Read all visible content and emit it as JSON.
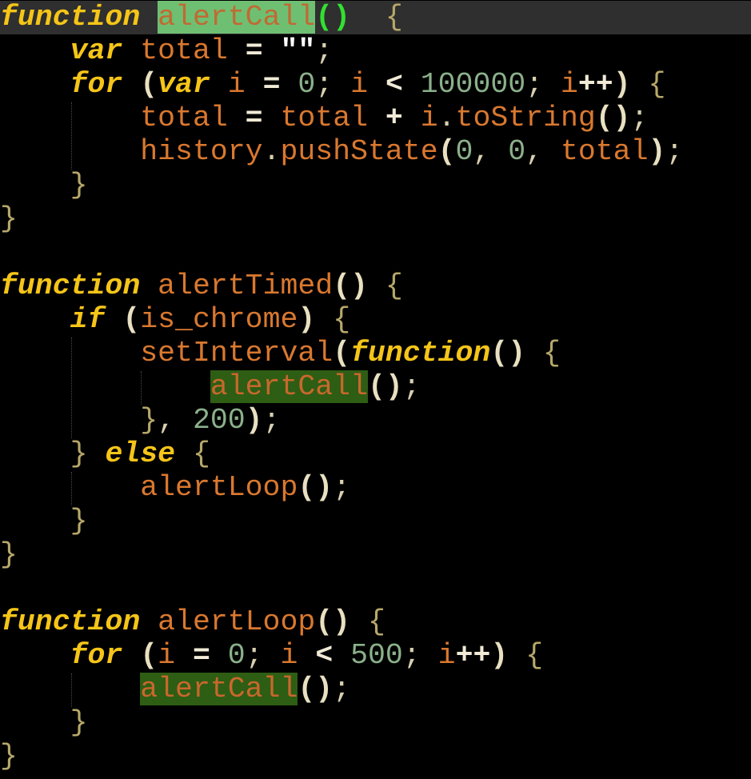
{
  "editor": {
    "language": "javascript",
    "current_line": 1,
    "colors": {
      "background": "#000000",
      "current_line": "#2f2f2f",
      "keyword": "#f5c518",
      "identifier": "#d9782f",
      "number": "#8bb08b",
      "selection_current": "#6fbf73",
      "selection_other": "#2e5d14",
      "matching_paren": "#32e032"
    },
    "lines": [
      {
        "n": 1,
        "indent": "",
        "tokens": [
          [
            "kw",
            "function"
          ],
          [
            "sp",
            " "
          ],
          [
            "hl-cur",
            "alertCall"
          ],
          [
            "paren-match",
            "()"
          ],
          [
            "sp",
            "  "
          ],
          [
            "brace",
            "{"
          ]
        ]
      },
      {
        "n": 2,
        "indent": "    ",
        "tokens": [
          [
            "kw",
            "var"
          ],
          [
            "sp",
            " "
          ],
          [
            "id",
            "total"
          ],
          [
            "sp",
            " "
          ],
          [
            "op",
            "="
          ],
          [
            "sp",
            " "
          ],
          [
            "str",
            "\"\""
          ],
          [
            "punc",
            ";"
          ]
        ]
      },
      {
        "n": 3,
        "indent": "    ",
        "tokens": [
          [
            "kw",
            "for"
          ],
          [
            "sp",
            " "
          ],
          [
            "paren",
            "("
          ],
          [
            "kw",
            "var"
          ],
          [
            "sp",
            " "
          ],
          [
            "id",
            "i"
          ],
          [
            "sp",
            " "
          ],
          [
            "op",
            "="
          ],
          [
            "sp",
            " "
          ],
          [
            "num",
            "0"
          ],
          [
            "punc",
            ";"
          ],
          [
            "sp",
            " "
          ],
          [
            "id",
            "i"
          ],
          [
            "sp",
            " "
          ],
          [
            "op",
            "<"
          ],
          [
            "sp",
            " "
          ],
          [
            "num",
            "100000"
          ],
          [
            "punc",
            ";"
          ],
          [
            "sp",
            " "
          ],
          [
            "id",
            "i"
          ],
          [
            "op",
            "++"
          ],
          [
            "paren",
            ")"
          ],
          [
            "sp",
            " "
          ],
          [
            "brace",
            "{"
          ]
        ]
      },
      {
        "n": 4,
        "indent": "        ",
        "tokens": [
          [
            "id",
            "total"
          ],
          [
            "sp",
            " "
          ],
          [
            "op",
            "="
          ],
          [
            "sp",
            " "
          ],
          [
            "id",
            "total"
          ],
          [
            "sp",
            " "
          ],
          [
            "op",
            "+"
          ],
          [
            "sp",
            " "
          ],
          [
            "id",
            "i"
          ],
          [
            "punc",
            "."
          ],
          [
            "id",
            "toString"
          ],
          [
            "paren",
            "()"
          ],
          [
            "punc",
            ";"
          ]
        ]
      },
      {
        "n": 5,
        "indent": "        ",
        "tokens": [
          [
            "id",
            "history"
          ],
          [
            "punc",
            "."
          ],
          [
            "id",
            "pushState"
          ],
          [
            "paren",
            "("
          ],
          [
            "num",
            "0"
          ],
          [
            "punc",
            ","
          ],
          [
            "sp",
            " "
          ],
          [
            "num",
            "0"
          ],
          [
            "punc",
            ","
          ],
          [
            "sp",
            " "
          ],
          [
            "id",
            "total"
          ],
          [
            "paren",
            ")"
          ],
          [
            "punc",
            ";"
          ]
        ]
      },
      {
        "n": 6,
        "indent": "    ",
        "tokens": [
          [
            "brace",
            "}"
          ]
        ]
      },
      {
        "n": 7,
        "indent": "",
        "tokens": [
          [
            "brace",
            "}"
          ]
        ]
      },
      {
        "n": 8,
        "indent": "",
        "tokens": []
      },
      {
        "n": 9,
        "indent": "",
        "tokens": [
          [
            "kw",
            "function"
          ],
          [
            "sp",
            " "
          ],
          [
            "id",
            "alertTimed"
          ],
          [
            "paren",
            "()"
          ],
          [
            "sp",
            " "
          ],
          [
            "brace",
            "{"
          ]
        ]
      },
      {
        "n": 10,
        "indent": "    ",
        "tokens": [
          [
            "kw",
            "if"
          ],
          [
            "sp",
            " "
          ],
          [
            "paren",
            "("
          ],
          [
            "id",
            "is_chrome"
          ],
          [
            "paren",
            ")"
          ],
          [
            "sp",
            " "
          ],
          [
            "brace",
            "{"
          ]
        ]
      },
      {
        "n": 11,
        "indent": "        ",
        "tokens": [
          [
            "id",
            "setInterval"
          ],
          [
            "paren",
            "("
          ],
          [
            "kw",
            "function"
          ],
          [
            "paren",
            "()"
          ],
          [
            "sp",
            " "
          ],
          [
            "brace",
            "{"
          ]
        ]
      },
      {
        "n": 12,
        "indent": "            ",
        "tokens": [
          [
            "hl",
            "alertCall"
          ],
          [
            "paren",
            "()"
          ],
          [
            "punc",
            ";"
          ]
        ]
      },
      {
        "n": 13,
        "indent": "        ",
        "tokens": [
          [
            "brace",
            "}"
          ],
          [
            "punc",
            ","
          ],
          [
            "sp",
            " "
          ],
          [
            "num",
            "200"
          ],
          [
            "paren",
            ")"
          ],
          [
            "punc",
            ";"
          ]
        ]
      },
      {
        "n": 14,
        "indent": "    ",
        "tokens": [
          [
            "brace",
            "}"
          ],
          [
            "sp",
            " "
          ],
          [
            "kw",
            "else"
          ],
          [
            "sp",
            " "
          ],
          [
            "brace",
            "{"
          ]
        ]
      },
      {
        "n": 15,
        "indent": "        ",
        "tokens": [
          [
            "id",
            "alertLoop"
          ],
          [
            "paren",
            "()"
          ],
          [
            "punc",
            ";"
          ]
        ]
      },
      {
        "n": 16,
        "indent": "    ",
        "tokens": [
          [
            "brace",
            "}"
          ]
        ]
      },
      {
        "n": 17,
        "indent": "",
        "tokens": [
          [
            "brace",
            "}"
          ]
        ]
      },
      {
        "n": 18,
        "indent": "",
        "tokens": []
      },
      {
        "n": 19,
        "indent": "",
        "tokens": [
          [
            "kw",
            "function"
          ],
          [
            "sp",
            " "
          ],
          [
            "id",
            "alertLoop"
          ],
          [
            "paren",
            "()"
          ],
          [
            "sp",
            " "
          ],
          [
            "brace",
            "{"
          ]
        ]
      },
      {
        "n": 20,
        "indent": "    ",
        "tokens": [
          [
            "kw",
            "for"
          ],
          [
            "sp",
            " "
          ],
          [
            "paren",
            "("
          ],
          [
            "id",
            "i"
          ],
          [
            "sp",
            " "
          ],
          [
            "op",
            "="
          ],
          [
            "sp",
            " "
          ],
          [
            "num",
            "0"
          ],
          [
            "punc",
            ";"
          ],
          [
            "sp",
            " "
          ],
          [
            "id",
            "i"
          ],
          [
            "sp",
            " "
          ],
          [
            "op",
            "<"
          ],
          [
            "sp",
            " "
          ],
          [
            "num",
            "500"
          ],
          [
            "punc",
            ";"
          ],
          [
            "sp",
            " "
          ],
          [
            "id",
            "i"
          ],
          [
            "op",
            "++"
          ],
          [
            "paren",
            ")"
          ],
          [
            "sp",
            " "
          ],
          [
            "brace",
            "{"
          ]
        ]
      },
      {
        "n": 21,
        "indent": "        ",
        "tokens": [
          [
            "hl",
            "alertCall"
          ],
          [
            "paren",
            "()"
          ],
          [
            "punc",
            ";"
          ]
        ]
      },
      {
        "n": 22,
        "indent": "    ",
        "tokens": [
          [
            "brace",
            "}"
          ]
        ]
      },
      {
        "n": 23,
        "indent": "",
        "tokens": [
          [
            "brace",
            "}"
          ]
        ]
      }
    ]
  }
}
